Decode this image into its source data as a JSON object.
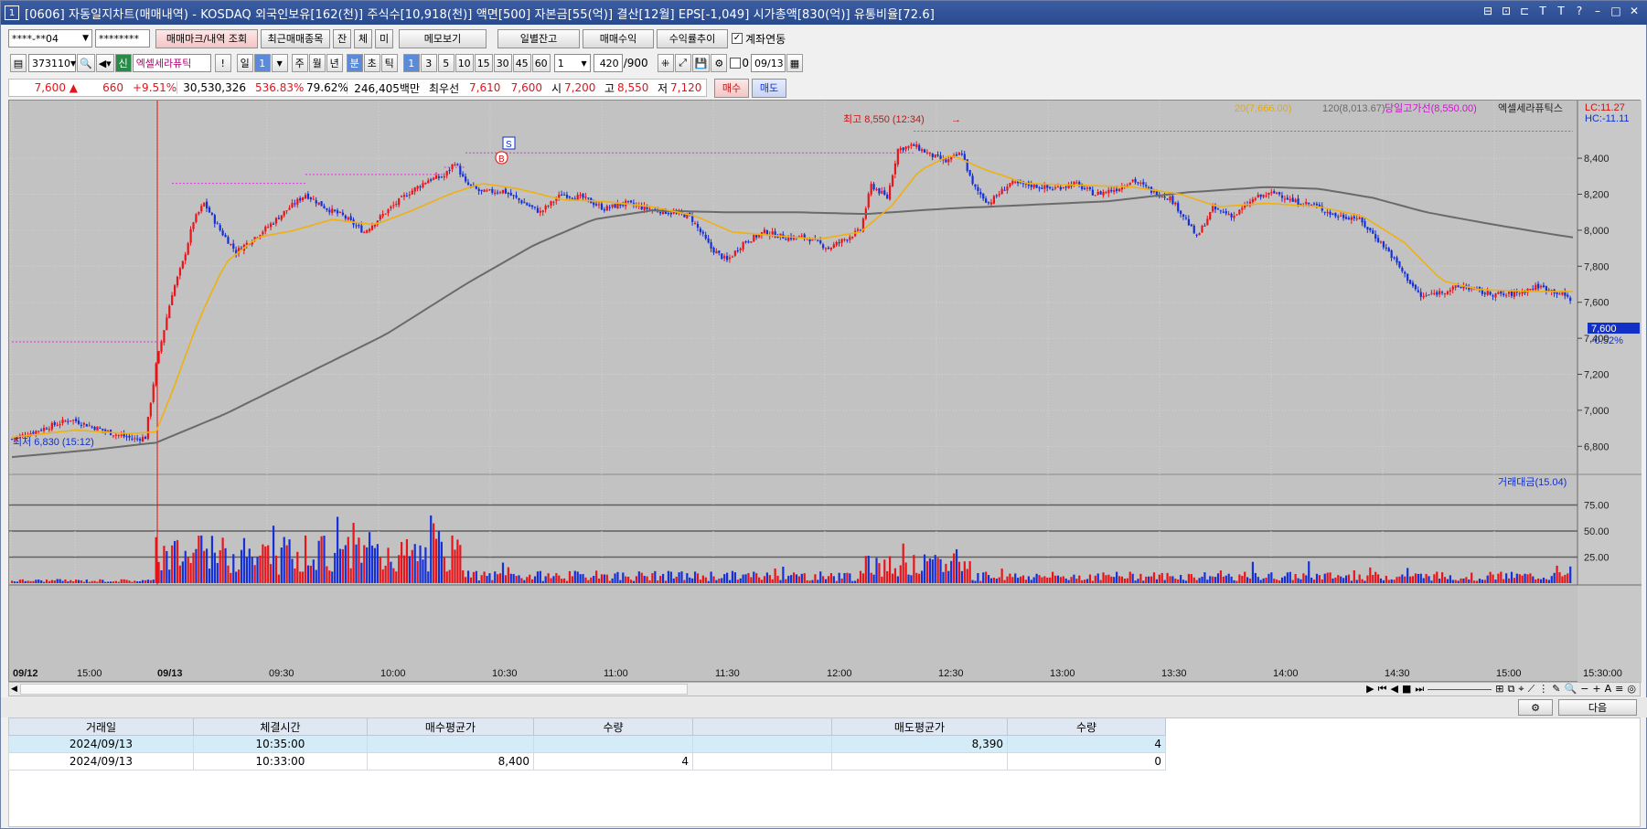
{
  "title": {
    "num": "1",
    "text": "[0606] 자동일지차트(매매내역) - KOSDAQ 외국인보유[162(천)] 주식수[10,918(천)] 액면[500] 자본금[55(억)] 결산[12월] EPS[-1,049] 시가총액[830(억)] 유통비율[72.6]",
    "controls": [
      "⊟",
      "⊡",
      "⊏",
      "T",
      "T",
      "?",
      "–",
      "□",
      "✕"
    ]
  },
  "toolbar1": {
    "account": "****-**04",
    "password": "********",
    "btn_marks": "매매마크/내역 조회",
    "btn_recent": "최근매매종목",
    "btn_jan": "잔",
    "btn_che": "체",
    "btn_mi": "미",
    "btn_memo": "메모보기",
    "btn_daily": "일별잔고",
    "btn_profit": "매매수익",
    "btn_trend": "수익률추이",
    "link_check": "✓",
    "link_label": "계좌연동"
  },
  "toolbar2": {
    "code": "373110",
    "shin": "신",
    "stock_name": "엑셀세라퓨틱",
    "excl": "!",
    "periods": [
      "일",
      "1",
      "주",
      "월",
      "년",
      "분",
      "초",
      "틱"
    ],
    "mins": [
      "1",
      "3",
      "5",
      "10",
      "15",
      "30",
      "45",
      "60"
    ],
    "mult": "1",
    "count": "420",
    "count_max": "/900",
    "zero": "0",
    "date": "09/13"
  },
  "quote": {
    "price": "7,600 ▲",
    "change": "660",
    "pct": "+9.51%",
    "volume": "30,530,326",
    "vol_ratio": "536.83%",
    "turnover": "79.62%",
    "amount": "246,405백만",
    "ask_label": "최우선",
    "ask": "7,610",
    "bid": "7,600",
    "open_label": "시",
    "open": "7,200",
    "high_label": "고",
    "high": "8,550",
    "low_label": "저",
    "low": "7,120",
    "buy": "매수",
    "sell": "매도"
  },
  "chart_data": {
    "type": "candlestick",
    "legend": {
      "ma20": "20(7,666.00)",
      "ma120": "120(8,013.67)",
      "high_line": "당일고가선(8,550.00)",
      "name": "엑셀세라퓨틱스",
      "lc": "LC:11.27",
      "hc": "HC:-11.11"
    },
    "annotations": {
      "high": "최고 8,550 (12:34)",
      "low": "최저 6,830 (15:12)",
      "marker_s": "S",
      "marker_b": "B",
      "last_price": "7,600",
      "last_pct": "-0.52%"
    },
    "price_ticks": [
      "8,400",
      "8,200",
      "8,000",
      "7,800",
      "7,600",
      "7,400",
      "7,200",
      "7,000",
      "6,800"
    ],
    "price_tick_values": [
      8400,
      8200,
      8000,
      7800,
      7600,
      7400,
      7200,
      7000,
      6800
    ],
    "price_ylim": [
      6700,
      8700
    ],
    "volume_title": "거래대금(15.04)",
    "volume_ticks": [
      "75.00",
      "50.00",
      "25.00"
    ],
    "volume_tick_values": [
      75,
      50,
      25
    ],
    "volume_ylim": [
      0,
      100
    ],
    "time_labels": [
      "09/12",
      "15:00",
      "09/13",
      "09:30",
      "10:00",
      "10:30",
      "11:00",
      "11:30",
      "12:00",
      "12:30",
      "13:00",
      "13:30",
      "14:00",
      "14:30",
      "15:00",
      "15:30:00"
    ],
    "close_path": [
      [
        0,
        6840
      ],
      [
        10,
        6890
      ],
      [
        22,
        6950
      ],
      [
        32,
        6900
      ],
      [
        38,
        6870
      ],
      [
        46,
        6840
      ],
      [
        50,
        6850
      ],
      [
        54,
        7250
      ],
      [
        60,
        7650
      ],
      [
        64,
        7820
      ],
      [
        68,
        8050
      ],
      [
        72,
        8150
      ],
      [
        78,
        8000
      ],
      [
        84,
        7880
      ],
      [
        90,
        7950
      ],
      [
        96,
        8020
      ],
      [
        102,
        8100
      ],
      [
        110,
        8200
      ],
      [
        118,
        8120
      ],
      [
        124,
        8080
      ],
      [
        132,
        7990
      ],
      [
        140,
        8100
      ],
      [
        148,
        8200
      ],
      [
        156,
        8280
      ],
      [
        162,
        8300
      ],
      [
        166,
        8380
      ],
      [
        170,
        8260
      ],
      [
        176,
        8210
      ],
      [
        184,
        8220
      ],
      [
        192,
        8150
      ],
      [
        198,
        8100
      ],
      [
        206,
        8200
      ],
      [
        214,
        8180
      ],
      [
        222,
        8120
      ],
      [
        230,
        8150
      ],
      [
        238,
        8120
      ],
      [
        246,
        8100
      ],
      [
        254,
        8080
      ],
      [
        262,
        7900
      ],
      [
        268,
        7830
      ],
      [
        274,
        7930
      ],
      [
        282,
        7990
      ],
      [
        290,
        7960
      ],
      [
        298,
        7960
      ],
      [
        306,
        7900
      ],
      [
        312,
        7950
      ],
      [
        318,
        8000
      ],
      [
        322,
        8250
      ],
      [
        328,
        8180
      ],
      [
        332,
        8450
      ],
      [
        338,
        8470
      ],
      [
        344,
        8420
      ],
      [
        350,
        8380
      ],
      [
        356,
        8430
      ],
      [
        360,
        8250
      ],
      [
        366,
        8150
      ],
      [
        374,
        8260
      ],
      [
        382,
        8250
      ],
      [
        390,
        8230
      ],
      [
        398,
        8260
      ],
      [
        406,
        8200
      ],
      [
        414,
        8230
      ],
      [
        420,
        8280
      ],
      [
        428,
        8210
      ],
      [
        434,
        8180
      ],
      [
        440,
        8060
      ],
      [
        444,
        7960
      ],
      [
        450,
        8120
      ],
      [
        458,
        8080
      ],
      [
        466,
        8180
      ],
      [
        474,
        8210
      ],
      [
        480,
        8160
      ],
      [
        488,
        8140
      ],
      [
        496,
        8080
      ],
      [
        504,
        8070
      ],
      [
        510,
        7980
      ],
      [
        516,
        7880
      ],
      [
        522,
        7750
      ],
      [
        528,
        7630
      ],
      [
        536,
        7660
      ],
      [
        544,
        7690
      ],
      [
        552,
        7650
      ],
      [
        560,
        7640
      ],
      [
        566,
        7660
      ],
      [
        572,
        7690
      ],
      [
        580,
        7650
      ],
      [
        585,
        7610
      ]
    ],
    "ma20_path": [
      [
        0,
        6850
      ],
      [
        24,
        6890
      ],
      [
        44,
        6870
      ],
      [
        54,
        6880
      ],
      [
        60,
        7100
      ],
      [
        70,
        7500
      ],
      [
        80,
        7820
      ],
      [
        92,
        7960
      ],
      [
        106,
        8000
      ],
      [
        120,
        8060
      ],
      [
        136,
        8030
      ],
      [
        150,
        8110
      ],
      [
        164,
        8200
      ],
      [
        176,
        8260
      ],
      [
        190,
        8230
      ],
      [
        206,
        8170
      ],
      [
        222,
        8160
      ],
      [
        240,
        8130
      ],
      [
        256,
        8080
      ],
      [
        270,
        7990
      ],
      [
        286,
        7970
      ],
      [
        302,
        7950
      ],
      [
        318,
        7990
      ],
      [
        330,
        8140
      ],
      [
        340,
        8330
      ],
      [
        352,
        8420
      ],
      [
        364,
        8340
      ],
      [
        380,
        8260
      ],
      [
        400,
        8250
      ],
      [
        420,
        8240
      ],
      [
        438,
        8200
      ],
      [
        452,
        8130
      ],
      [
        470,
        8150
      ],
      [
        490,
        8130
      ],
      [
        506,
        8080
      ],
      [
        522,
        7930
      ],
      [
        536,
        7720
      ],
      [
        550,
        7670
      ],
      [
        570,
        7660
      ],
      [
        585,
        7660
      ]
    ],
    "ma120_path": [
      [
        0,
        6740
      ],
      [
        30,
        6780
      ],
      [
        54,
        6820
      ],
      [
        80,
        6980
      ],
      [
        110,
        7200
      ],
      [
        140,
        7420
      ],
      [
        170,
        7700
      ],
      [
        196,
        7920
      ],
      [
        218,
        8060
      ],
      [
        240,
        8110
      ],
      [
        266,
        8100
      ],
      [
        294,
        8100
      ],
      [
        320,
        8090
      ],
      [
        350,
        8120
      ],
      [
        380,
        8140
      ],
      [
        410,
        8160
      ],
      [
        440,
        8210
      ],
      [
        470,
        8240
      ],
      [
        490,
        8230
      ],
      [
        510,
        8180
      ],
      [
        530,
        8100
      ],
      [
        552,
        8040
      ],
      [
        572,
        7990
      ],
      [
        585,
        7960
      ]
    ],
    "volume_bars_note": "volume bars generated from seeded pattern"
  },
  "bottom": {
    "next": "다음",
    "gear": "⚙"
  },
  "table": {
    "headers": [
      "거래일",
      "체결시간",
      "매수평균가",
      "수량",
      "",
      "매도평균가",
      "수량"
    ],
    "rows": [
      [
        "2024/09/13",
        "10:35:00",
        "",
        "",
        "",
        "8,390",
        "4"
      ],
      [
        "2024/09/13",
        "10:33:00",
        "8,400",
        "4",
        "",
        "",
        "0"
      ]
    ]
  }
}
